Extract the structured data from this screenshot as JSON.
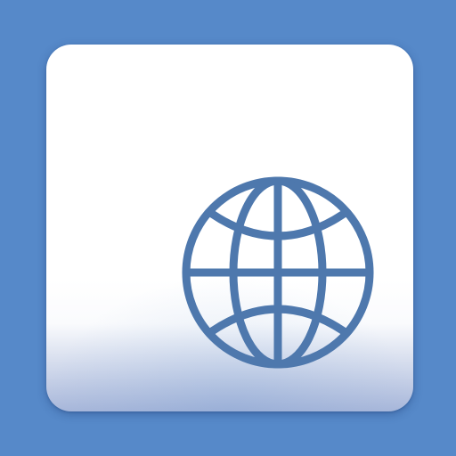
{
  "colors": {
    "background": "#5689C9",
    "tile_top": "#FFFFFF",
    "tile_mid": "#FAFBFD",
    "tile_bottom": "#A8B7DA",
    "icon_stroke": "#4E78AD"
  },
  "icon": {
    "name": "globe-icon"
  }
}
